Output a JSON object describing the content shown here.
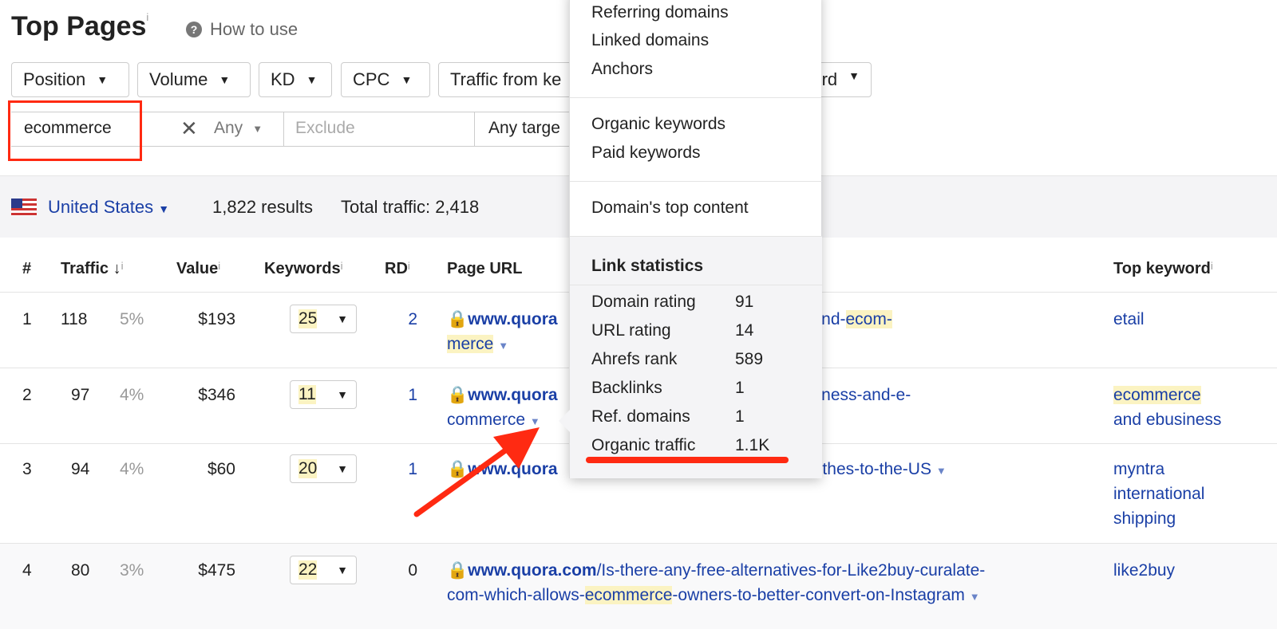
{
  "header": {
    "title": "Top Pages",
    "info": "i",
    "how_to_use": "How to use"
  },
  "filters": [
    "Position",
    "Volume",
    "KD",
    "CPC",
    "Traffic from ke",
    "rd"
  ],
  "search": {
    "value": "ecommerce",
    "mode": "Any",
    "exclude_placeholder": "Exclude",
    "target": "Any targe"
  },
  "summary": {
    "country": "United States",
    "results": "1,822 results",
    "total_traffic": "Total traffic: 2,418"
  },
  "columns": {
    "num": "#",
    "traffic": "Traffic",
    "value": "Value",
    "keywords": "Keywords",
    "rd": "RD",
    "page_url": "Page URL",
    "top_keyword": "Top keyword"
  },
  "rows": [
    {
      "num": "1",
      "traffic": "118",
      "pct": "5%",
      "value": "$193",
      "keywords": "25",
      "rd": "2",
      "url_domain": "www.quora",
      "url_rest": "-between-etail-and-",
      "url_hl": "ecom-",
      "url_line2_hl": "merce",
      "top_keyword": "etail"
    },
    {
      "num": "2",
      "traffic": "97",
      "pct": "4%",
      "value": "$346",
      "keywords": "11",
      "rd": "1",
      "url_domain": "www.quora",
      "url_rest": "-between-e-business-and-e-",
      "url_line2": "commerce",
      "top_keyword_hl": "ecommerce",
      "top_keyword": "and ebusiness"
    },
    {
      "num": "3",
      "traffic": "94",
      "pct": "4%",
      "value": "$60",
      "keywords": "20",
      "rd": "1",
      "url_domain": "www.quora",
      "url_rest": "tra-ship-clothes-to-the-US",
      "top_keyword": "myntra international shipping"
    },
    {
      "num": "4",
      "traffic": "80",
      "pct": "3%",
      "value": "$475",
      "keywords": "22",
      "rd": "0",
      "url_domain": "www.quora.com",
      "url_rest": "/Is-there-any-free-alternatives-for-Like2buy-curalate-",
      "url_line2a": "com-which-allows-",
      "url_line2_hl": "ecommerce",
      "url_line2b": "-owners-to-better-convert-on-Instagram",
      "top_keyword": "like2buy"
    }
  ],
  "popup": {
    "menu1": [
      "Referring domains",
      "Linked domains",
      "Anchors"
    ],
    "menu2": [
      "Organic keywords",
      "Paid keywords"
    ],
    "menu3": [
      "Domain's top content"
    ],
    "stats_title": "Link statistics",
    "stats": [
      {
        "label": "Domain rating",
        "value": "91"
      },
      {
        "label": "URL rating",
        "value": "14"
      },
      {
        "label": "Ahrefs rank",
        "value": "589"
      },
      {
        "label": "Backlinks",
        "value": "1"
      },
      {
        "label": "Ref. domains",
        "value": "1"
      },
      {
        "label": "Organic traffic",
        "value": "1.1K"
      }
    ]
  },
  "colors": {
    "link": "#1a3fa6",
    "highlight": "#fbf3c2",
    "annotation": "#ff2a12"
  }
}
